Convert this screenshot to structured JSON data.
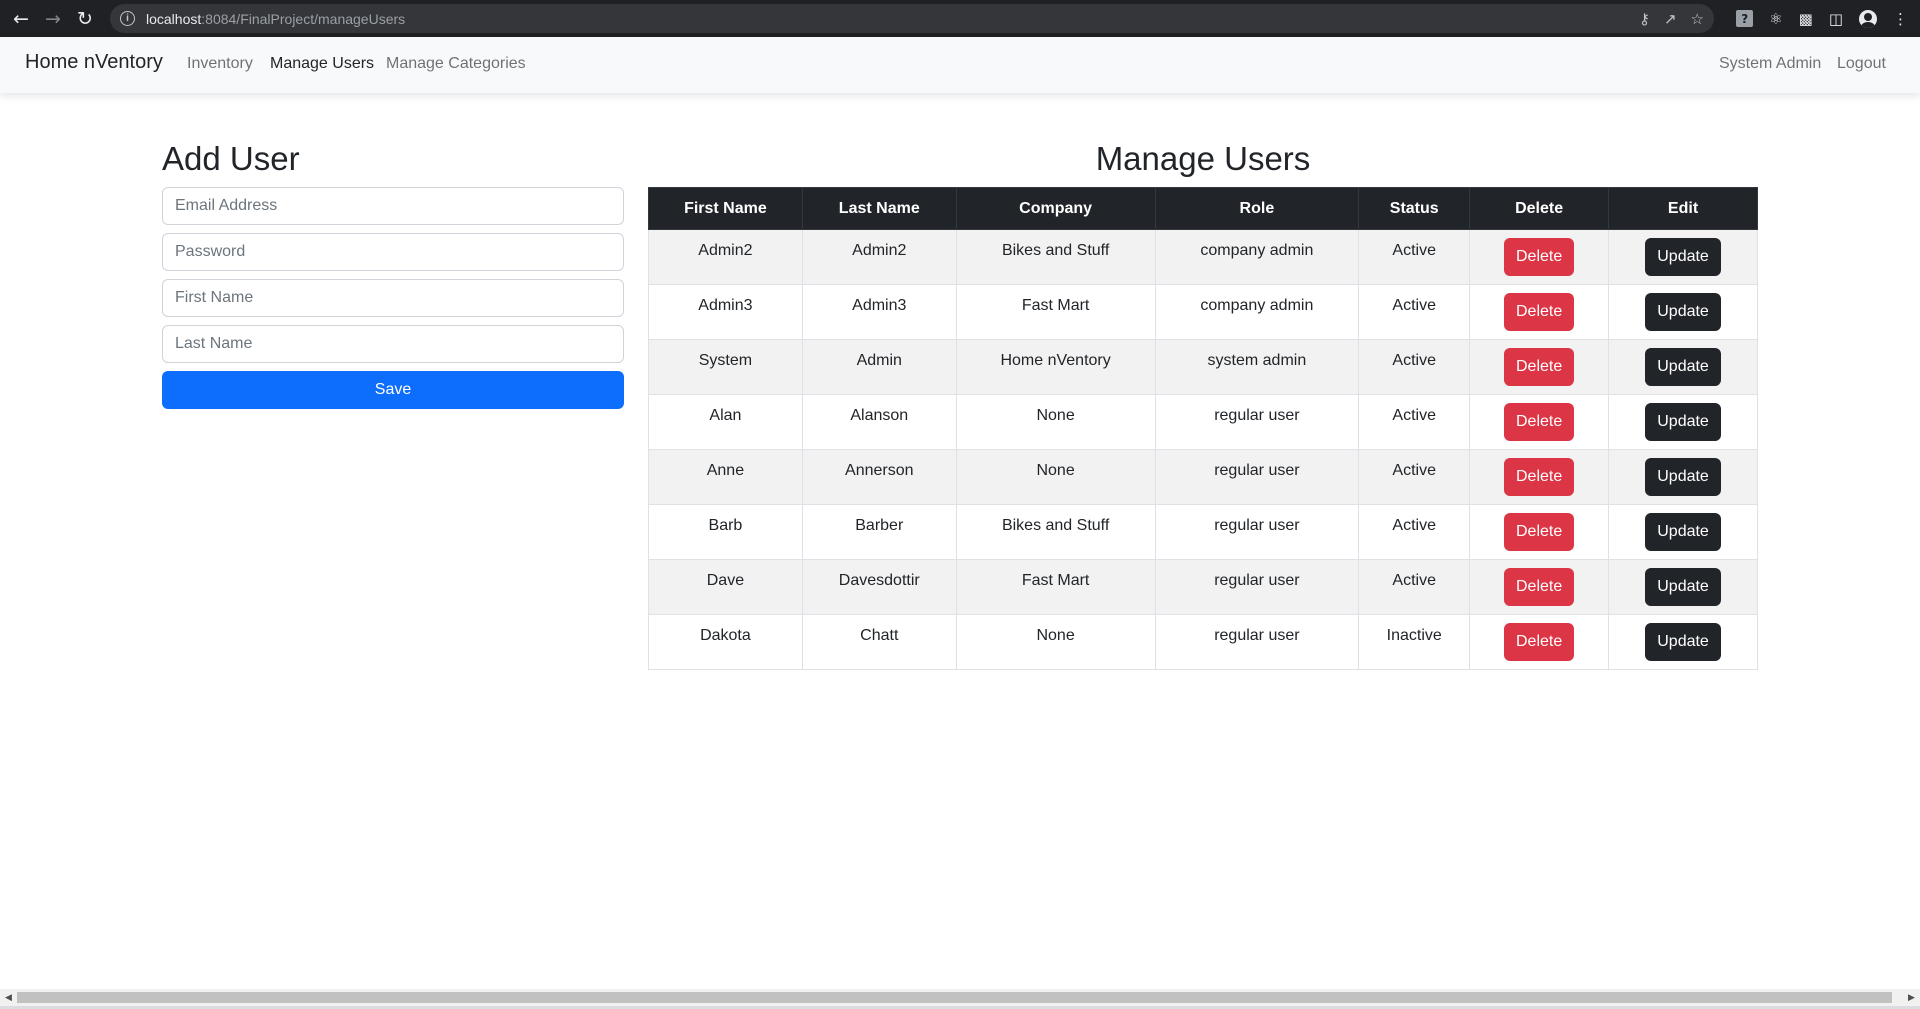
{
  "browser": {
    "url_host": "localhost",
    "url_rest": ":8084/FinalProject/manageUsers",
    "icons": [
      "back-icon",
      "forward-icon",
      "reload-icon",
      "site-info-icon",
      "key-icon",
      "share-icon",
      "star-icon",
      "extension-help-icon",
      "extension-atom-icon",
      "puzzle-icon",
      "side-panel-icon",
      "profile-icon",
      "kebab-menu-icon"
    ]
  },
  "navbar": {
    "brand": "Home nVentory",
    "links": {
      "inventory": "Inventory",
      "manage_users": "Manage Users",
      "manage_categories": "Manage Categories"
    },
    "user": "System Admin",
    "logout": "Logout"
  },
  "add_user": {
    "title": "Add User",
    "email_placeholder": "Email Address",
    "password_placeholder": "Password",
    "first_name_placeholder": "First Name",
    "last_name_placeholder": "Last Name",
    "save_label": "Save"
  },
  "manage_users": {
    "title": "Manage Users",
    "columns": [
      "First Name",
      "Last Name",
      "Company",
      "Role",
      "Status",
      "Delete",
      "Edit"
    ],
    "delete_label": "Delete",
    "update_label": "Update",
    "rows": [
      {
        "first": "Admin2",
        "last": "Admin2",
        "company": "Bikes and Stuff",
        "role": "company admin",
        "status": "Active"
      },
      {
        "first": "Admin3",
        "last": "Admin3",
        "company": "Fast Mart",
        "role": "company admin",
        "status": "Active"
      },
      {
        "first": "System",
        "last": "Admin",
        "company": "Home nVentory",
        "role": "system admin",
        "status": "Active"
      },
      {
        "first": "Alan",
        "last": "Alanson",
        "company": "None",
        "role": "regular user",
        "status": "Active"
      },
      {
        "first": "Anne",
        "last": "Annerson",
        "company": "None",
        "role": "regular user",
        "status": "Active"
      },
      {
        "first": "Barb",
        "last": "Barber",
        "company": "Bikes and Stuff",
        "role": "regular user",
        "status": "Active"
      },
      {
        "first": "Dave",
        "last": "Davesdottir",
        "company": "Fast Mart",
        "role": "regular user",
        "status": "Active"
      },
      {
        "first": "Dakota",
        "last": "Chatt",
        "company": "None",
        "role": "regular user",
        "status": "Inactive"
      }
    ]
  },
  "colors": {
    "primary": "#0d6efd",
    "danger": "#dc3545",
    "dark": "#212529",
    "navbar_bg": "#f8f9fa"
  }
}
